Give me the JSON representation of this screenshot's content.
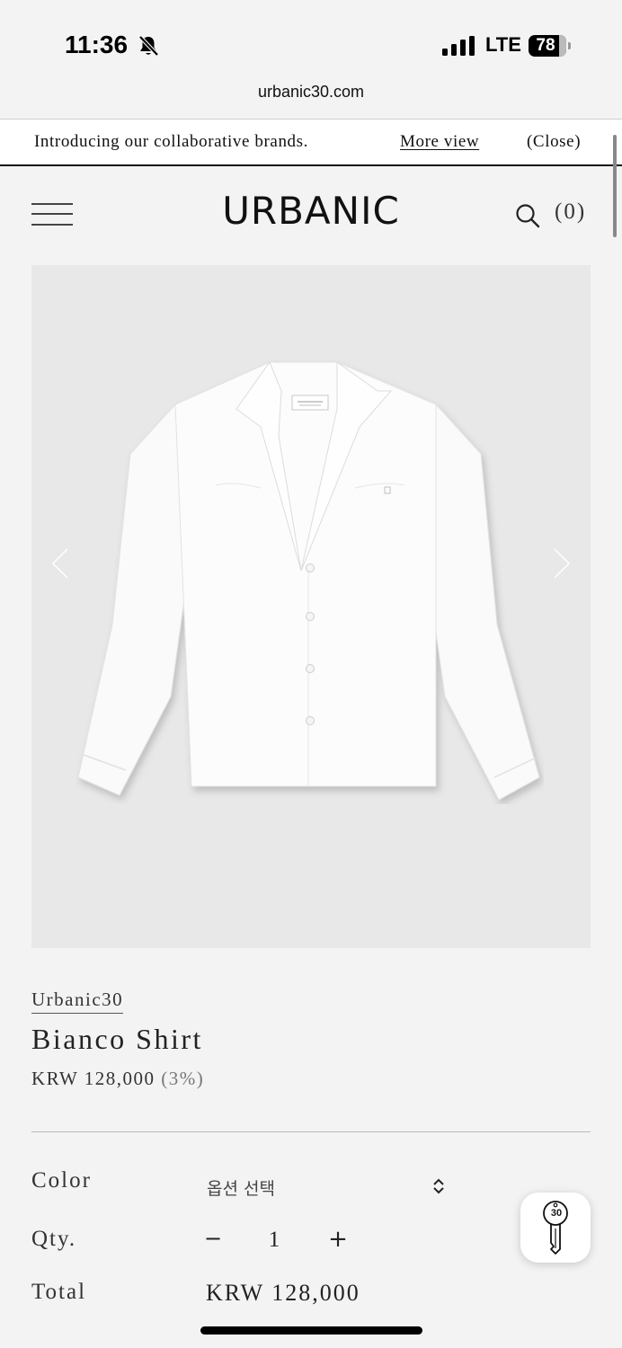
{
  "status_bar": {
    "time": "11:36",
    "network": "LTE",
    "battery": "78",
    "icons": [
      "bell-slash-icon",
      "signal-icon"
    ]
  },
  "browser": {
    "url": "urbanic30.com"
  },
  "announcement": {
    "text": "Introducing our collaborative brands.",
    "more_link": "More view",
    "close": "(Close)"
  },
  "header": {
    "logo": "URBANIC",
    "cart_count": "(0)",
    "icons": [
      "menu-icon",
      "search-icon"
    ]
  },
  "product": {
    "brand": "Urbanic30",
    "name": "Bianco Shirt",
    "price": "KRW 128,000",
    "discount": "(3%)",
    "options": {
      "color_label": "Color",
      "color_placeholder": "옵션 선택",
      "qty_label": "Qty.",
      "qty_minus": "−",
      "qty_value": "1",
      "qty_plus": "+",
      "total_label": "Total",
      "total_value": "KRW 128,000"
    }
  },
  "floating_button": {
    "label": "30",
    "icon": "key-icon"
  },
  "colors": {
    "background": "#f3f3f3",
    "image_background": "#e8e8e8",
    "text": "#222222"
  }
}
